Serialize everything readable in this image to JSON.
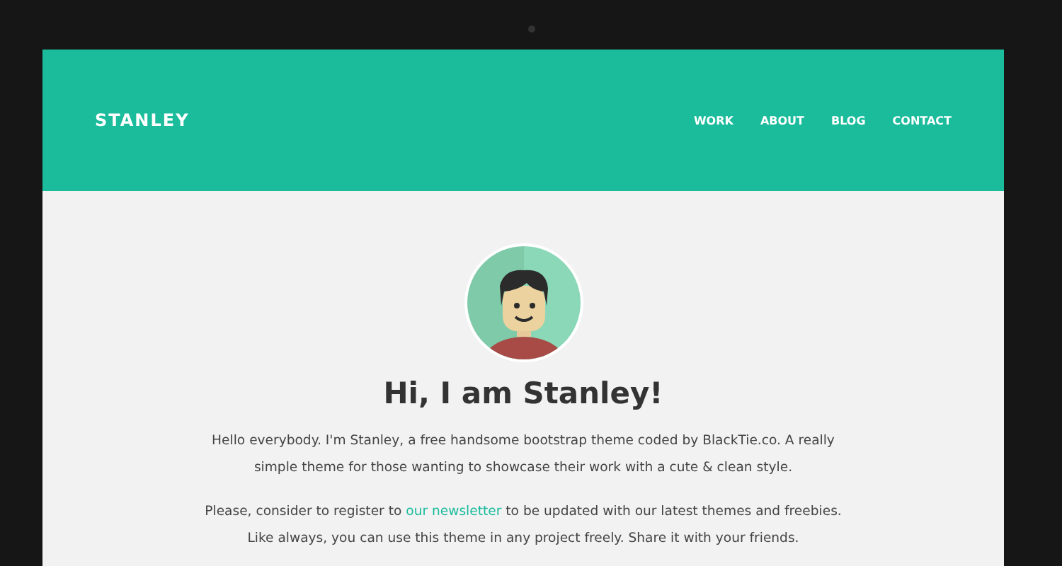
{
  "brand": "STANLEY",
  "nav": [
    {
      "label": "WORK"
    },
    {
      "label": "ABOUT"
    },
    {
      "label": "BLOG"
    },
    {
      "label": "CONTACT"
    }
  ],
  "heading": "Hi, I am Stanley!",
  "intro": "Hello everybody. I'm Stanley, a free handsome bootstrap theme coded by BlackTie.co. A really simple theme for those wanting to showcase their work with a cute & clean style.",
  "newsletter": {
    "before": "Please, consider to register to",
    "link": "our newsletter",
    "after": "to be updated with our latest themes and freebies. Like always, you can use this theme in any project freely. Share it with your friends."
  }
}
